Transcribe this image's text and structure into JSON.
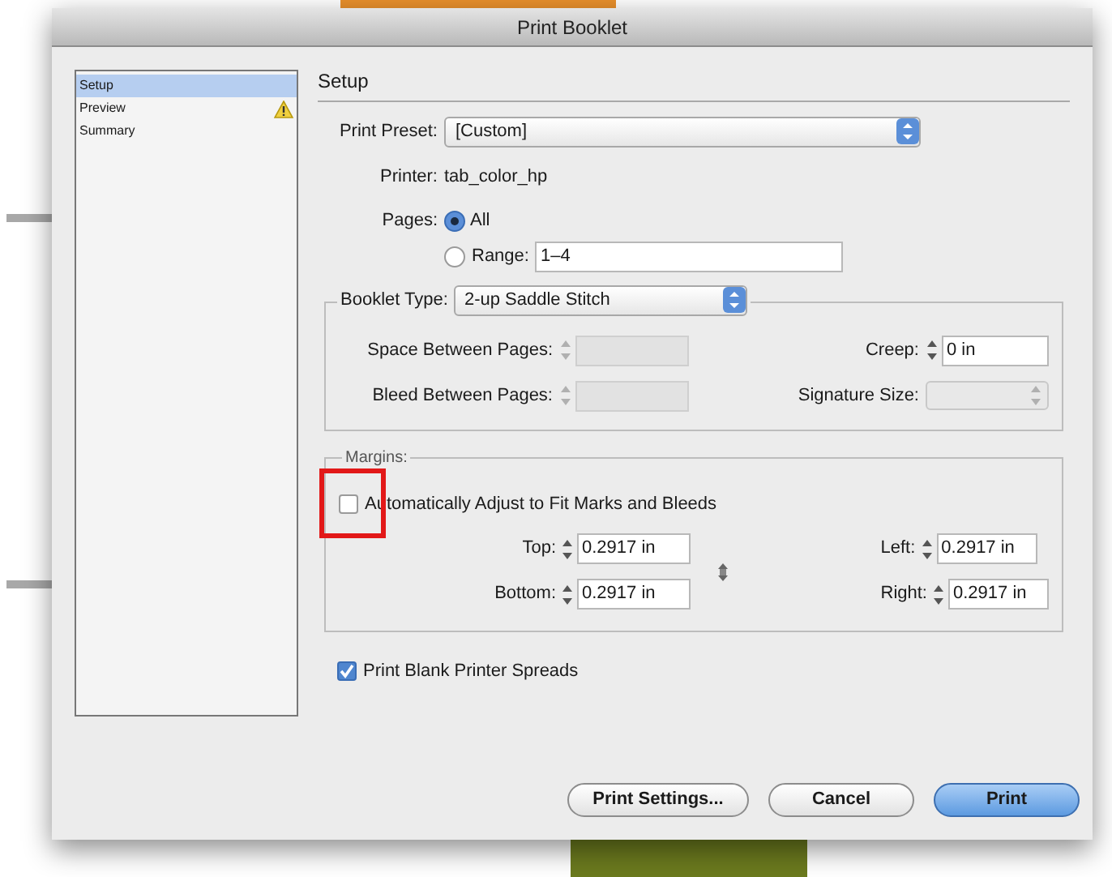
{
  "window": {
    "title": "Print Booklet"
  },
  "sidebar": {
    "items": [
      {
        "label": "Setup",
        "selected": true,
        "warning": false
      },
      {
        "label": "Preview",
        "selected": false,
        "warning": true
      },
      {
        "label": "Summary",
        "selected": false,
        "warning": false
      }
    ]
  },
  "section_title": "Setup",
  "print_preset": {
    "label": "Print Preset:",
    "value": "[Custom]"
  },
  "printer": {
    "label": "Printer:",
    "value": "tab_color_hp"
  },
  "pages": {
    "label": "Pages:",
    "options": [
      {
        "label": "All",
        "selected": true
      },
      {
        "label": "Range:",
        "selected": false
      }
    ],
    "range_value": "1–4"
  },
  "booklet": {
    "label": "Booklet Type:",
    "value": "2-up Saddle Stitch",
    "rows": [
      [
        {
          "kind": "spinner",
          "label": "Space Between Pages:",
          "disabled": true
        },
        {
          "kind": "spinner",
          "label": "Creep:",
          "value": "0 in",
          "disabled": false
        }
      ],
      [
        {
          "kind": "spinner",
          "label": "Bleed Between Pages:",
          "disabled": true
        },
        {
          "kind": "dropdown",
          "label": "Signature Size:",
          "disabled": true
        }
      ]
    ]
  },
  "margins": {
    "legend": "Margins:",
    "auto_adjust": {
      "label": "Automatically Adjust to Fit Marks and Bleeds",
      "checked": false,
      "highlighted": true
    },
    "rows": [
      [
        {
          "label": "Top:",
          "value": "0.2917 in"
        },
        {
          "label": "Left:",
          "value": "0.2917 in"
        }
      ],
      [
        {
          "label": "Bottom:",
          "value": "0.2917 in"
        },
        {
          "label": "Right:",
          "value": "0.2917 in"
        }
      ]
    ]
  },
  "print_blank": {
    "label": "Print Blank Printer Spreads",
    "checked": true
  },
  "buttons": [
    {
      "label": "Print Settings...",
      "default": false
    },
    {
      "label": "Cancel",
      "default": false
    },
    {
      "label": "Print",
      "default": true
    }
  ]
}
